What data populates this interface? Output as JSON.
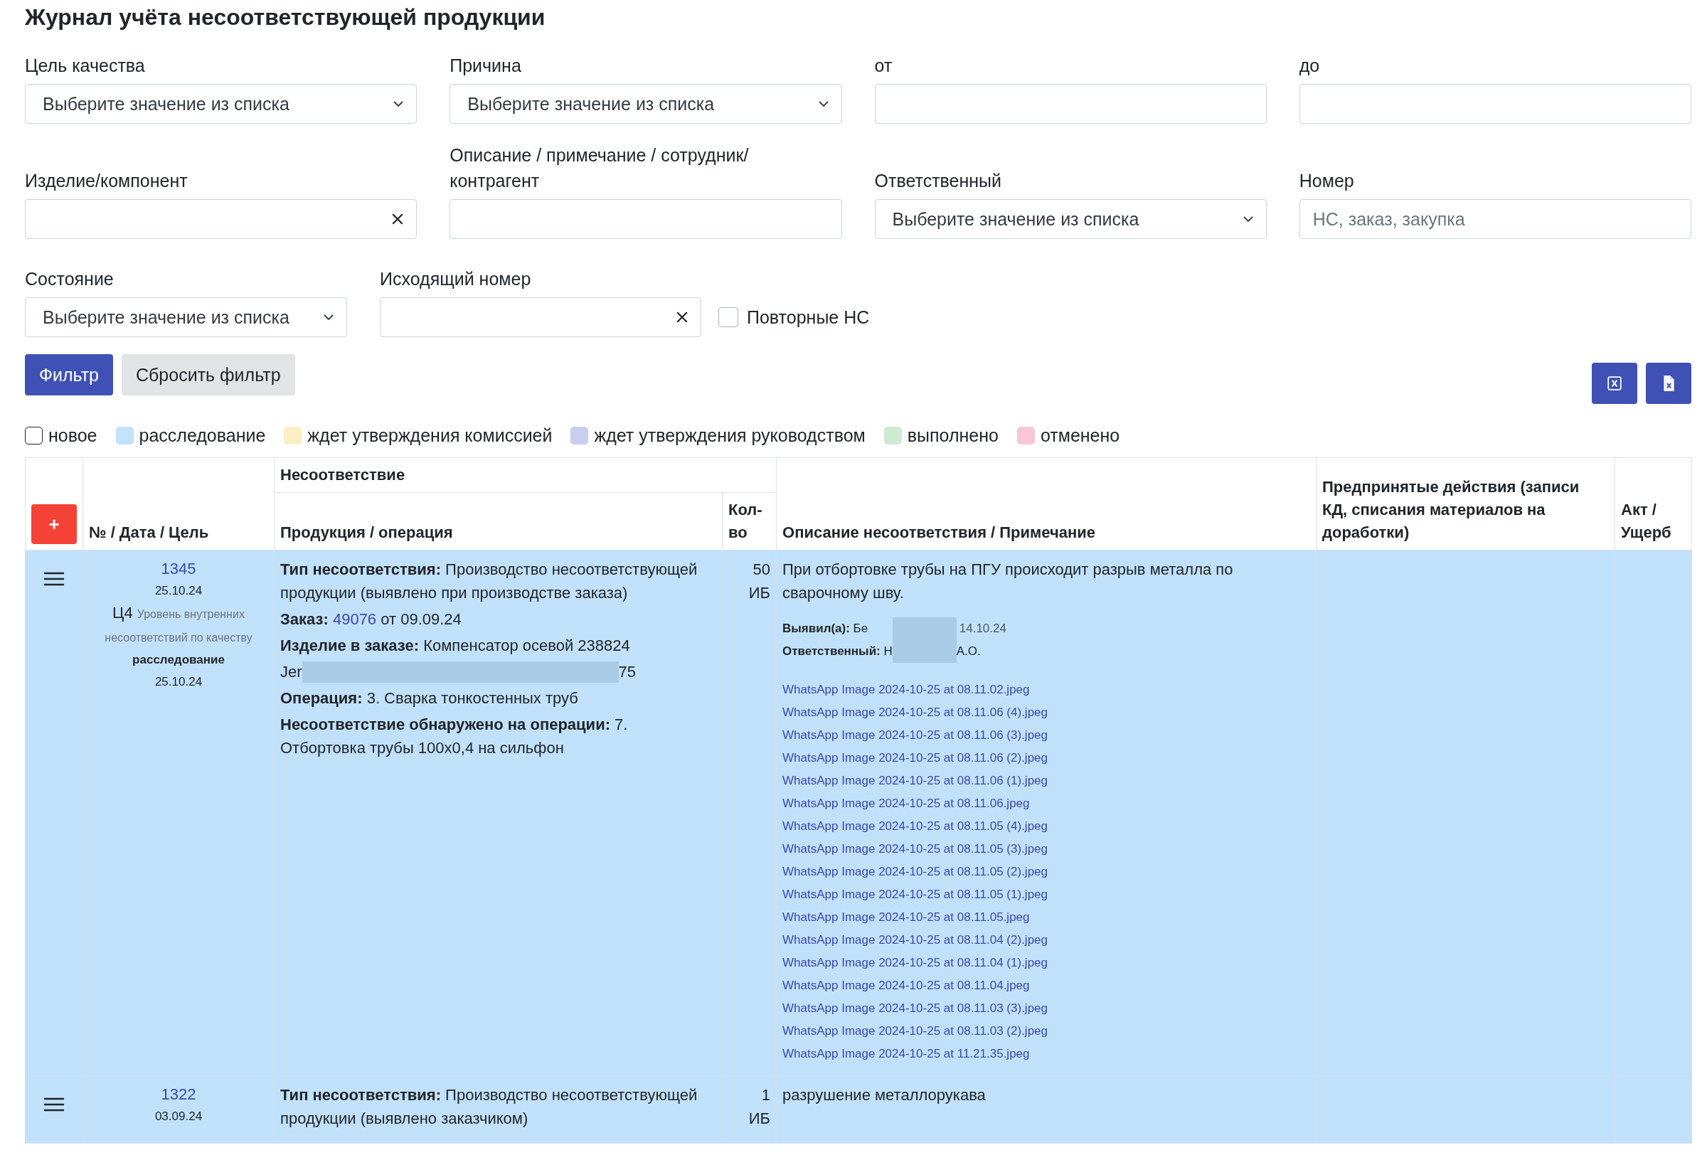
{
  "title": "Журнал учёта несоответствующей продукции",
  "filter_rows": [
    [
      {
        "kind": "select",
        "label": "Цель качества",
        "value": "Выберите значение из списка"
      },
      {
        "kind": "select",
        "label": "Причина",
        "value": "Выберите значение из списка"
      },
      {
        "kind": "text",
        "label": "от"
      },
      {
        "kind": "text",
        "label": "до"
      }
    ],
    [
      {
        "kind": "clearable",
        "label": "Изделие/компонент"
      },
      {
        "kind": "text",
        "label": "Описание / примечание / сотрудник/ контрагент"
      },
      {
        "kind": "select",
        "label": "Ответственный",
        "value": "Выберите значение из списка"
      },
      {
        "kind": "text",
        "label": "Номер",
        "placeholder": "НС, заказ, закупка"
      }
    ],
    [
      {
        "kind": "select",
        "label": "Состояние",
        "value": "Выберите значение из списка"
      },
      {
        "kind": "clearable",
        "label": "Исходящий номер"
      },
      {
        "kind": "checkbox",
        "label": "Повторные НС",
        "checked": false
      }
    ]
  ],
  "buttons": [
    {
      "label": "Фильтр",
      "kind": "primary"
    },
    {
      "label": "Сбросить фильтр",
      "kind": "secondary"
    }
  ],
  "legend": [
    {
      "label": "новое",
      "color": "#ffffff"
    },
    {
      "label": "расследование",
      "color": "#c3e2fb"
    },
    {
      "label": "ждет утверждения комиссией",
      "color": "#fdefc3"
    },
    {
      "label": "ждет утверждения руководством",
      "color": "#c9cdee"
    },
    {
      "label": "выполнено",
      "color": "#cdebd3"
    },
    {
      "label": "отменено",
      "color": "#f9c6d6"
    }
  ],
  "table": {
    "add_button": "+",
    "group_header": "Несоответствие",
    "columns": [
      "№ / Дата / Цель",
      "Продукция / операция",
      "Кол-во",
      "Описание несоответствия / Примечание",
      "Предпринятые действия (записи КД, списания материалов на доработки)",
      "Акт / Ущерб"
    ],
    "rows": [
      {
        "color": "#c1e1fb",
        "number": "1345",
        "date": "25.10.24",
        "goal_code": "Ц4",
        "goal_text": "Уровень внутренних несоответствий по качеству",
        "state": "расследование",
        "state_date": "25.10.24",
        "product": [
          {
            "kind": "text",
            "text": "**Тип несоответствия:** Производство несоответствующей продукции (выявлено при производстве заказа)"
          },
          {
            "kind": "order",
            "label": "Заказ:",
            "link": "49076",
            "rest": "от 09.09.24"
          },
          {
            "kind": "text",
            "text": "**Изделие в заказе:** Компенсатор осевой 238824"
          },
          {
            "kind": "redacted",
            "start": "Jer",
            "end": "75"
          },
          {
            "kind": "text",
            "text": "**Операция:** 3. Сварка тонкостенных труб"
          },
          {
            "kind": "text",
            "text": "**Несоответствие обнаружено на операции:** 7. Отбортовка трубы 100x0,4 на сильфон"
          }
        ],
        "qty": "50",
        "unit": "ИБ",
        "description": "При отбортовке трубы на ПГУ происходит разрыв металла по сварочному шву.",
        "found_by": {
          "label": "Выявил(а):",
          "start": "Бе",
          "end": "14.10.24"
        },
        "responsible": {
          "label": "Ответственный:",
          "start": "Н",
          "end": "А.О."
        },
        "attachments": [
          "WhatsApp Image 2024-10-25 at 08.11.02.jpeg",
          "WhatsApp Image 2024-10-25 at 08.11.06 (4).jpeg",
          "WhatsApp Image 2024-10-25 at 08.11.06 (3).jpeg",
          "WhatsApp Image 2024-10-25 at 08.11.06 (2).jpeg",
          "WhatsApp Image 2024-10-25 at 08.11.06 (1).jpeg",
          "WhatsApp Image 2024-10-25 at 08.11.06.jpeg",
          "WhatsApp Image 2024-10-25 at 08.11.05 (4).jpeg",
          "WhatsApp Image 2024-10-25 at 08.11.05 (3).jpeg",
          "WhatsApp Image 2024-10-25 at 08.11.05 (2).jpeg",
          "WhatsApp Image 2024-10-25 at 08.11.05 (1).jpeg",
          "WhatsApp Image 2024-10-25 at 08.11.05.jpeg",
          "WhatsApp Image 2024-10-25 at 08.11.04 (2).jpeg",
          "WhatsApp Image 2024-10-25 at 08.11.04 (1).jpeg",
          "WhatsApp Image 2024-10-25 at 08.11.04.jpeg",
          "WhatsApp Image 2024-10-25 at 08.11.03 (3).jpeg",
          "WhatsApp Image 2024-10-25 at 08.11.03 (2).jpeg",
          "WhatsApp Image 2024-10-25 at 11.21.35.jpeg"
        ]
      },
      {
        "color": "#c1e1fb",
        "number": "1322",
        "date": "03.09.24",
        "product": [
          {
            "kind": "text",
            "text": "**Тип несоответствия:** Производство несоответствующей продукции (выявлено заказчиком)"
          }
        ],
        "qty": "1",
        "unit": "ИБ",
        "description": "разрушение металлорукава"
      }
    ]
  }
}
